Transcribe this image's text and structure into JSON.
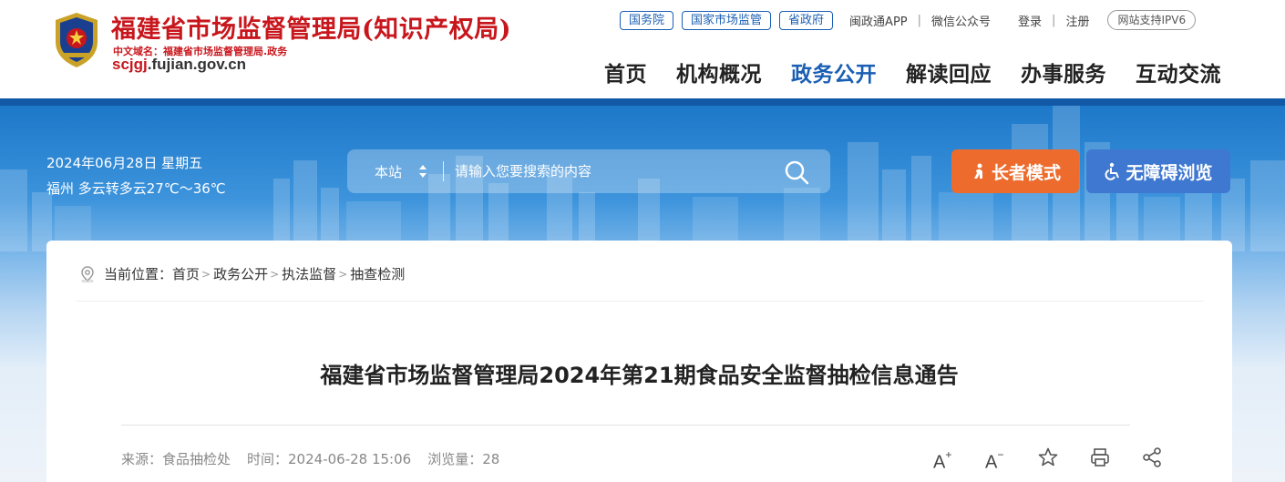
{
  "header": {
    "site_title": "福建省市场监督管理局(知识产权局)",
    "cn_domain": "中文域名：福建省市场监督管理局.政务",
    "domain_red": "scjgj",
    "domain_rest": ".fujian.gov.cn",
    "top_pills": [
      "国务院",
      "国家市场监管",
      "省政府"
    ],
    "top_links": [
      "闽政通APP",
      "微信公众号",
      "登录",
      "注册"
    ],
    "ipv6_label": "网站支持IPV6",
    "nav": [
      "首页",
      "机构概况",
      "政务公开",
      "解读回应",
      "办事服务",
      "互动交流"
    ],
    "active_nav": "政务公开"
  },
  "banner": {
    "date": "2024年06月28日 星期五",
    "weather": "福州 多云转多云27℃～36℃",
    "search_scope": "本站",
    "search_placeholder": "请输入您要搜索的内容",
    "elder_mode": "长者模式",
    "accessible": "无障碍浏览"
  },
  "breadcrumb": {
    "prefix": "当前位置：",
    "items": [
      "首页",
      "政务公开",
      "执法监督",
      "抽查检测"
    ]
  },
  "article": {
    "title": "福建省市场监督管理局2024年第21期食品安全监督抽检信息通告",
    "source": "来源：食品抽检处",
    "time": "时间：2024-06-28 15:06",
    "views": "浏览量：28"
  },
  "colors": {
    "brand_red": "#c8161d",
    "brand_blue": "#1158a6",
    "elder_orange": "#ec6b2d",
    "access_blue": "#3f78d0"
  }
}
